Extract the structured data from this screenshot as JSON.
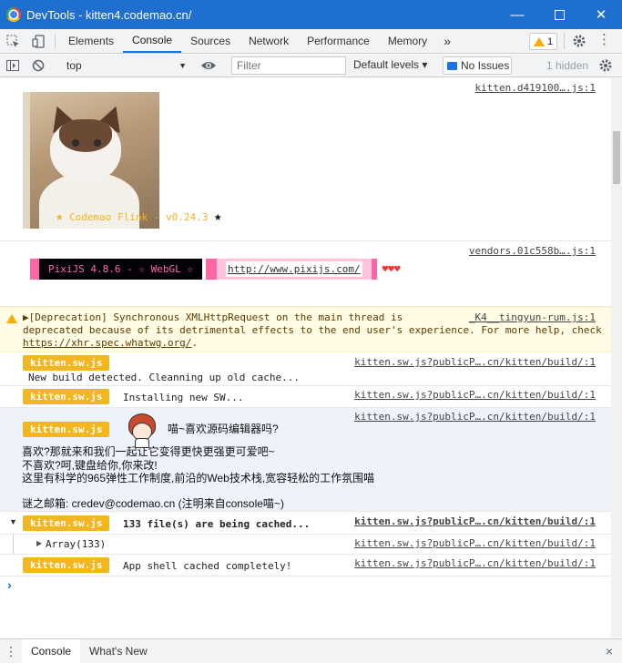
{
  "window": {
    "title": "DevTools - kitten4.codemao.cn/"
  },
  "tabs": [
    {
      "label": "Elements"
    },
    {
      "label": "Console"
    },
    {
      "label": "Sources"
    },
    {
      "label": "Network"
    },
    {
      "label": "Performance"
    },
    {
      "label": "Memory"
    }
  ],
  "more_tabs_label": "»",
  "warning_count": "1",
  "toolbar": {
    "context": "top",
    "filter_placeholder": "Filter",
    "levels_label": "Default levels ▾",
    "issues_label": "No Issues",
    "hidden_label": "1 hidden"
  },
  "messages": {
    "cat": {
      "source": "kitten.d419100….js:1",
      "banner": "Codemao Flink - v0.24.3"
    },
    "pixi": {
      "source": "vendors.01c558b….js:1",
      "banner": "PixiJS 4.8.6 - ☆ WebGL ☆",
      "url": "http://www.pixijs.com/",
      "hearts": "♥♥♥"
    },
    "deprecation": {
      "source": "_K4__tingyun-rum.js:1",
      "text_a": "▶[Deprecation] Synchronous XMLHttpRequest on the main thread is",
      "text_b": "deprecated because of its detrimental effects to the end user's experience. For more help, check",
      "link": "https://xhr.spec.whatwg.org/",
      "text_c": "."
    },
    "sw1": {
      "badge": "kitten.sw.js",
      "source": "kitten.sw.js?publicP….cn/kitten/build/:1",
      "text": "New build detected. Cleanning up old cache..."
    },
    "sw2": {
      "badge": "kitten.sw.js",
      "source": "kitten.sw.js?publicP….cn/kitten/build/:1",
      "text": "Installing new SW..."
    },
    "sw3": {
      "badge": "kitten.sw.js",
      "source": "kitten.sw.js?publicP….cn/kitten/build/:1",
      "heading": "喵~喜欢源码编辑器吗?",
      "line1": "喜欢?那就来和我们一起让它变得更快更强更可爱吧~",
      "line2": "不喜欢?呵,键盘给你,你来改!",
      "line3": "这里有科学的965弹性工作制度,前沿的Web技术栈,宽容轻松的工作氛围喵",
      "line4": "谜之邮箱: credev@codemao.cn (注明来自console喵~)"
    },
    "sw4": {
      "badge": "kitten.sw.js",
      "source": "kitten.sw.js?publicP….cn/kitten/build/:1",
      "text": "133 file(s) are being cached..."
    },
    "array": {
      "source": "kitten.sw.js?publicP….cn/kitten/build/:1",
      "text": "Array(133)"
    },
    "sw5": {
      "badge": "kitten.sw.js",
      "source": "kitten.sw.js?publicP….cn/kitten/build/:1",
      "text": "App shell cached completely!"
    }
  },
  "prompt": "›",
  "drawer": {
    "tabs": [
      {
        "label": "Console"
      },
      {
        "label": "What's New"
      }
    ],
    "close": "×"
  }
}
